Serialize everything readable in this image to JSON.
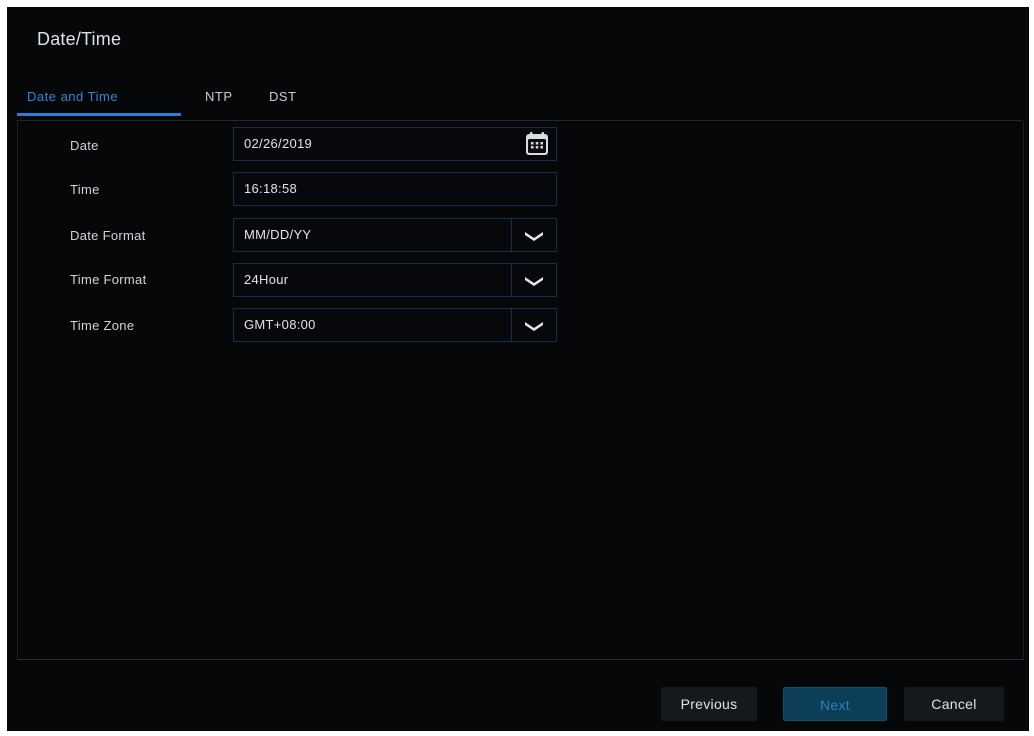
{
  "window": {
    "title": "Date/Time"
  },
  "tabs": [
    {
      "label": "Date and Time",
      "active": true
    },
    {
      "label": "NTP",
      "active": false
    },
    {
      "label": "DST",
      "active": false
    }
  ],
  "form": {
    "date": {
      "label": "Date",
      "value": "02/26/2019",
      "icon": "calendar-icon"
    },
    "time": {
      "label": "Time",
      "value": "16:18:58"
    },
    "date_format": {
      "label": "Date Format",
      "value": "MM/DD/YY",
      "icon": "chevron-down-icon"
    },
    "time_format": {
      "label": "Time Format",
      "value": "24Hour",
      "icon": "chevron-down-icon"
    },
    "time_zone": {
      "label": "Time Zone",
      "value": "GMT+08:00",
      "icon": "chevron-down-icon"
    }
  },
  "footer": {
    "previous_label": "Previous",
    "next_label": "Next",
    "cancel_label": "Cancel"
  },
  "colors": {
    "accent": "#2a7fd4",
    "background": "#060708",
    "field_border": "#1d2a4a",
    "primary_button": "#0c3e58"
  }
}
